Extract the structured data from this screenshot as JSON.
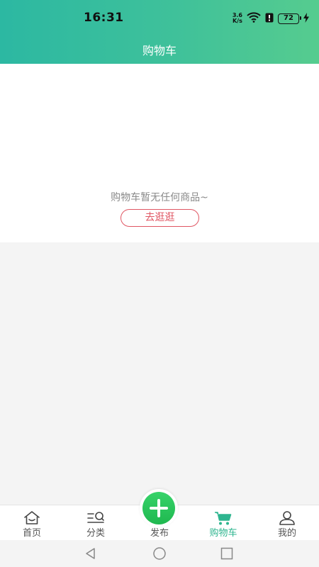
{
  "status_bar": {
    "time": "16:31",
    "net_speed_value": "3.6",
    "net_speed_unit": "K/s",
    "battery": "72"
  },
  "header": {
    "title": "购物车"
  },
  "empty_state": {
    "message": "购物车暂无任何商品~",
    "button_label": "去逛逛"
  },
  "tab_bar": {
    "tabs": [
      {
        "label": "首页",
        "icon": "home-icon"
      },
      {
        "label": "分类",
        "icon": "category-icon"
      },
      {
        "label": "发布",
        "icon": "plus-icon"
      },
      {
        "label": "购物车",
        "icon": "cart-icon",
        "active": true
      },
      {
        "label": "我的",
        "icon": "user-icon"
      }
    ]
  },
  "colors": {
    "header_gradient_start": "#2cb8a2",
    "header_gradient_end": "#56cc8f",
    "accent_green": "#2eb58f",
    "button_red": "#e05663"
  }
}
